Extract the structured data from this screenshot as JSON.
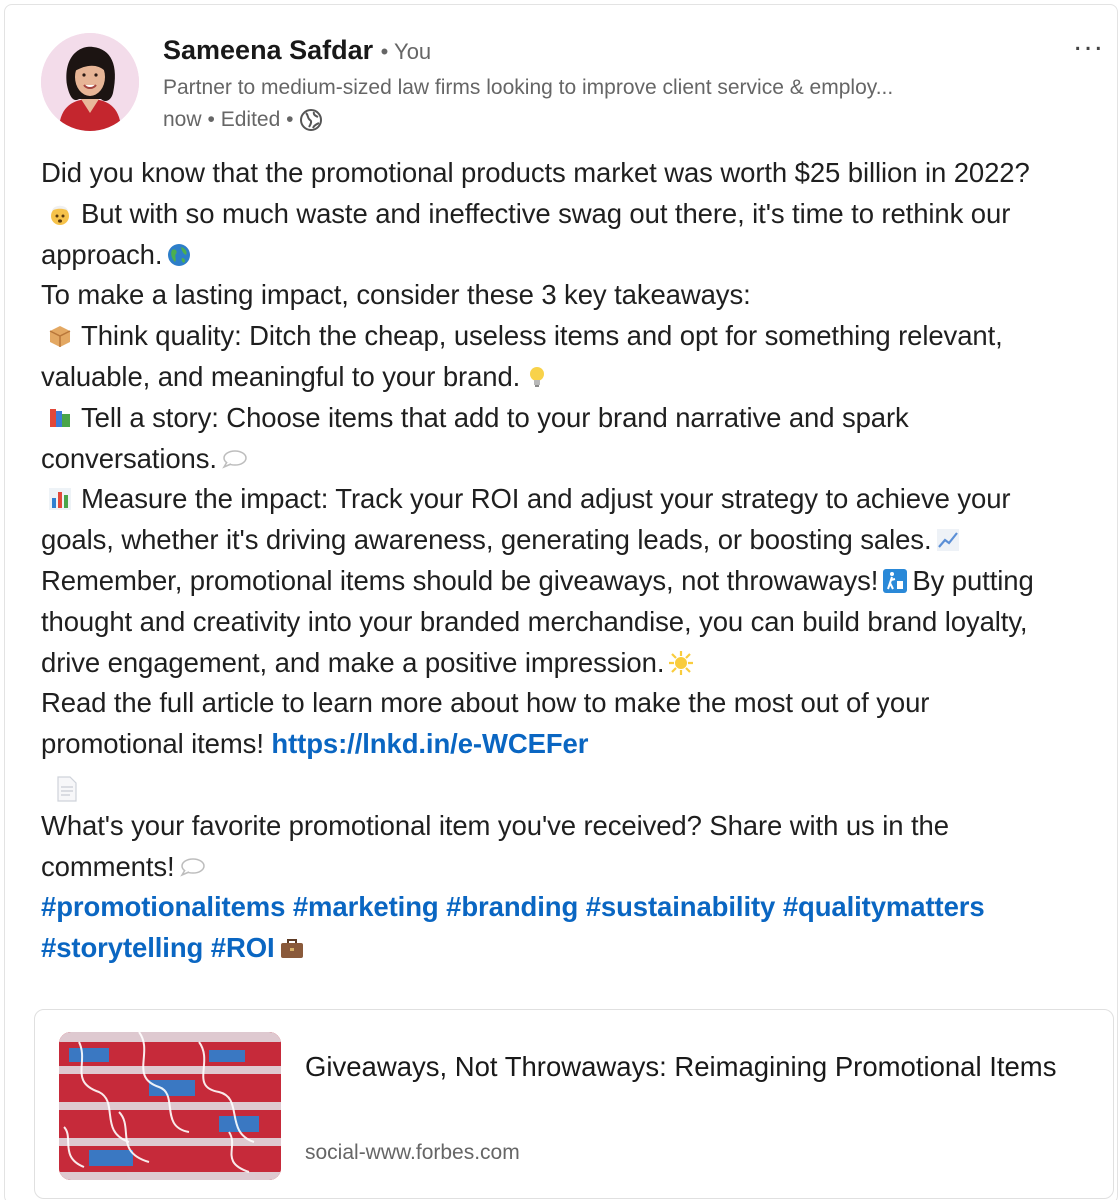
{
  "post": {
    "author": {
      "name": "Sameena Safdar",
      "relation": "• You",
      "headline": "Partner to medium-sized law firms looking to improve client service & employ...",
      "time": "now",
      "edited": "• Edited •",
      "visibility_icon": "globe-icon"
    },
    "more_label": "...",
    "lines": {
      "l1": "Did you know that the promotional products market was worth $25 billion in 2022?",
      "l2": "But with so much waste and ineffective swag out there, it's time to rethink our",
      "l3": "approach.",
      "l4": "To make a lasting impact, consider these 3 key takeaways:",
      "l5": "Think quality: Ditch the cheap, useless items and opt for something relevant,",
      "l6": "valuable, and meaningful to your brand.",
      "l7": "Tell a story: Choose items that add to your brand narrative and spark",
      "l8": "conversations.",
      "l9": "Measure the impact: Track your ROI and adjust your strategy to achieve your",
      "l10": "goals, whether it's driving awareness, generating leads, or boosting sales.",
      "l11a": "Remember, promotional items should be giveaways, not throwaways!",
      "l11b": "By putting",
      "l12": "thought and creativity into your branded merchandise, you can build brand loyalty,",
      "l13": "drive engagement, and make a positive impression.",
      "l14": "Read the full article to learn more about how to make the most out of your",
      "l15": "promotional items!",
      "link": "https://lnkd.in/e-WCEFer",
      "l17": "What's your favorite promotional item you've received? Share with us in the",
      "l18": "comments!"
    },
    "hashtags": {
      "h1": "#promotionalitems",
      "h2": "#marketing",
      "h3": "#branding",
      "h4": "#sustainability",
      "h5": "#qualitymatters",
      "h6": "#storytelling",
      "h7": "#ROI"
    },
    "emojis": [
      "exploding-head-emoji",
      "globe-emoji",
      "package-emoji",
      "lightbulb-emoji",
      "books-emoji",
      "speech-bubble-emoji",
      "bar-chart-emoji",
      "chart-increasing-emoji",
      "litter-bin-emoji",
      "sun-emoji",
      "page-icon",
      "briefcase-emoji"
    ],
    "article": {
      "title": "Giveaways, Not Throwaways: Reimagining Promotional Items",
      "source": "social-www.forbes.com"
    }
  },
  "colors": {
    "link": "#0a66c2",
    "text": "#1f1f1f",
    "muted": "#666666"
  }
}
